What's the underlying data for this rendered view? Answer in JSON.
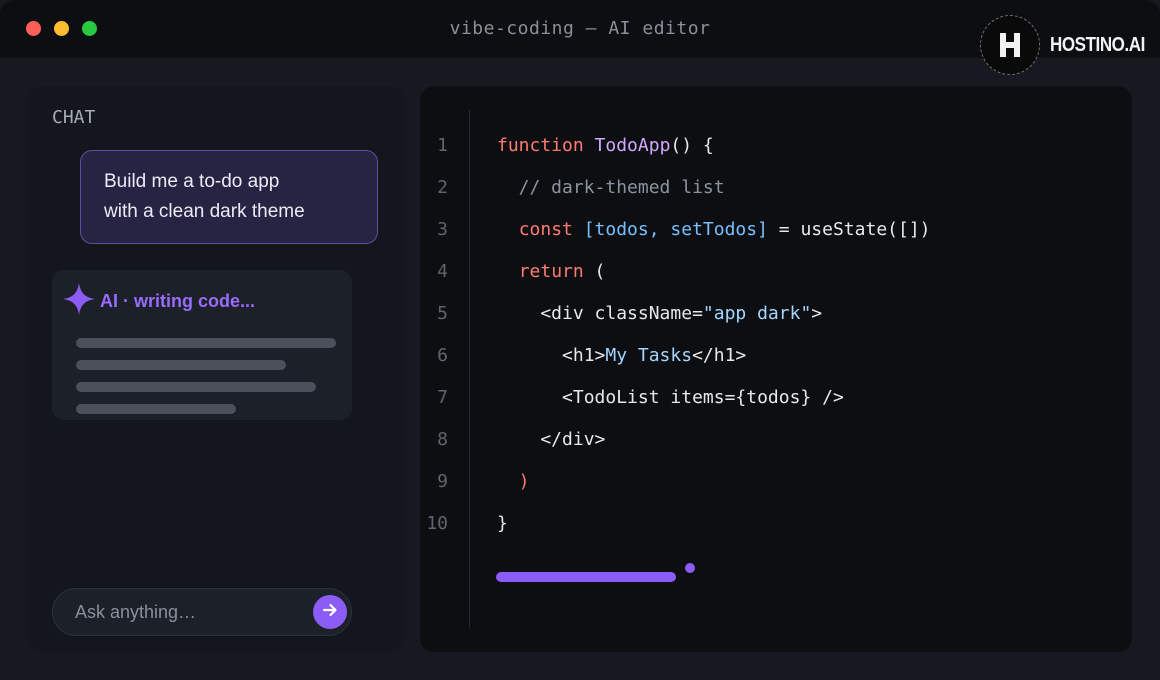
{
  "window": {
    "title": "vibe-coding — AI editor",
    "brand": "HOSTINO.AI",
    "brand_mark": "H"
  },
  "chat": {
    "label": "CHAT",
    "user_message": {
      "line1": "Build me a to-do app",
      "line2": "with a clean dark theme"
    },
    "ai_status": "AI · writing code...",
    "input_placeholder": "Ask anything…"
  },
  "editor": {
    "line_numbers": [
      "1",
      "2",
      "3",
      "4",
      "5",
      "6",
      "7",
      "8",
      "9",
      "10"
    ],
    "lines": [
      [
        {
          "t": "function",
          "c": "kw"
        },
        {
          "t": " ",
          "c": "pl"
        },
        {
          "t": "TodoApp",
          "c": "fn"
        },
        {
          "t": "() {",
          "c": "pl"
        }
      ],
      [
        {
          "t": "  // dark-themed list",
          "c": "cm"
        }
      ],
      [
        {
          "t": "  ",
          "c": "pl"
        },
        {
          "t": "const",
          "c": "kw"
        },
        {
          "t": " [todos, setTodos]",
          "c": "vr"
        },
        {
          "t": " = useState([])",
          "c": "pl"
        }
      ],
      [
        {
          "t": "  ",
          "c": "pl"
        },
        {
          "t": "return",
          "c": "kw"
        },
        {
          "t": " (",
          "c": "pl"
        }
      ],
      [
        {
          "t": "    <div className=",
          "c": "pl"
        },
        {
          "t": "\"app dark\"",
          "c": "str"
        },
        {
          "t": ">",
          "c": "pl"
        }
      ],
      [
        {
          "t": "      <h1>",
          "c": "pl"
        },
        {
          "t": "My Tasks",
          "c": "str"
        },
        {
          "t": "</h1>",
          "c": "pl"
        }
      ],
      [
        {
          "t": "      <TodoList items={todos} />",
          "c": "pl"
        }
      ],
      [
        {
          "t": "    </div>",
          "c": "pl"
        }
      ],
      [
        {
          "t": "  )",
          "c": "kw"
        }
      ],
      [
        {
          "t": "}",
          "c": "pl"
        }
      ]
    ]
  },
  "colors": {
    "accent": "#8b5cf6",
    "keyword": "#ff7b72",
    "function": "#d2a8ff",
    "comment": "#8b949e",
    "variable": "#79c0ff",
    "string": "#a5d6ff"
  },
  "icons": {
    "sparkle": "sparkle-icon",
    "send": "arrow-right-icon"
  }
}
